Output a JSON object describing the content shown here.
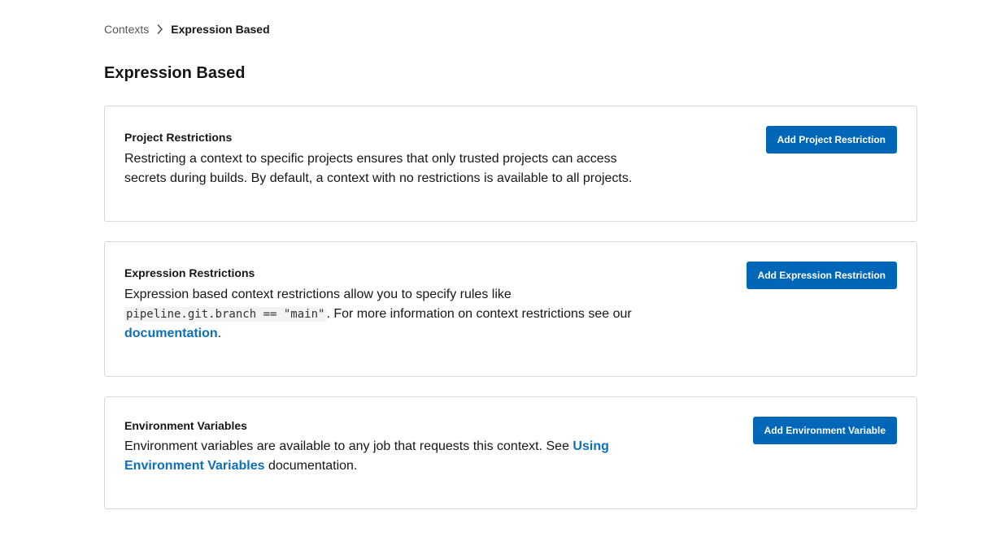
{
  "breadcrumb": {
    "parent": "Contexts",
    "current": "Expression Based",
    "separator_icon": "chevron-right-icon"
  },
  "page": {
    "title": "Expression Based"
  },
  "project_restrictions": {
    "title": "Project Restrictions",
    "description": "Restricting a context to specific projects ensures that only trusted projects can access secrets during builds. By default, a context with no restrictions is available to all projects.",
    "button_label": "Add Project Restriction"
  },
  "expression_restrictions": {
    "title": "Expression Restrictions",
    "description_prefix": "Expression based context restrictions allow you to specify rules like ",
    "code_example": "pipeline.git.branch == \"main\"",
    "description_middle": ". For more information on context restrictions see our ",
    "link_text": "documentation",
    "description_suffix": ".",
    "button_label": "Add Expression Restriction"
  },
  "environment_variables": {
    "title": "Environment Variables",
    "description_prefix": "Environment variables are available to any job that requests this context. See ",
    "link_text": "Using Environment Variables",
    "description_suffix": " documentation.",
    "button_label": "Add Environment Variable"
  },
  "colors": {
    "primary_button": "#0067b8",
    "link": "#0e6fb6",
    "card_border": "#d9d9d9",
    "text": "#161616"
  }
}
